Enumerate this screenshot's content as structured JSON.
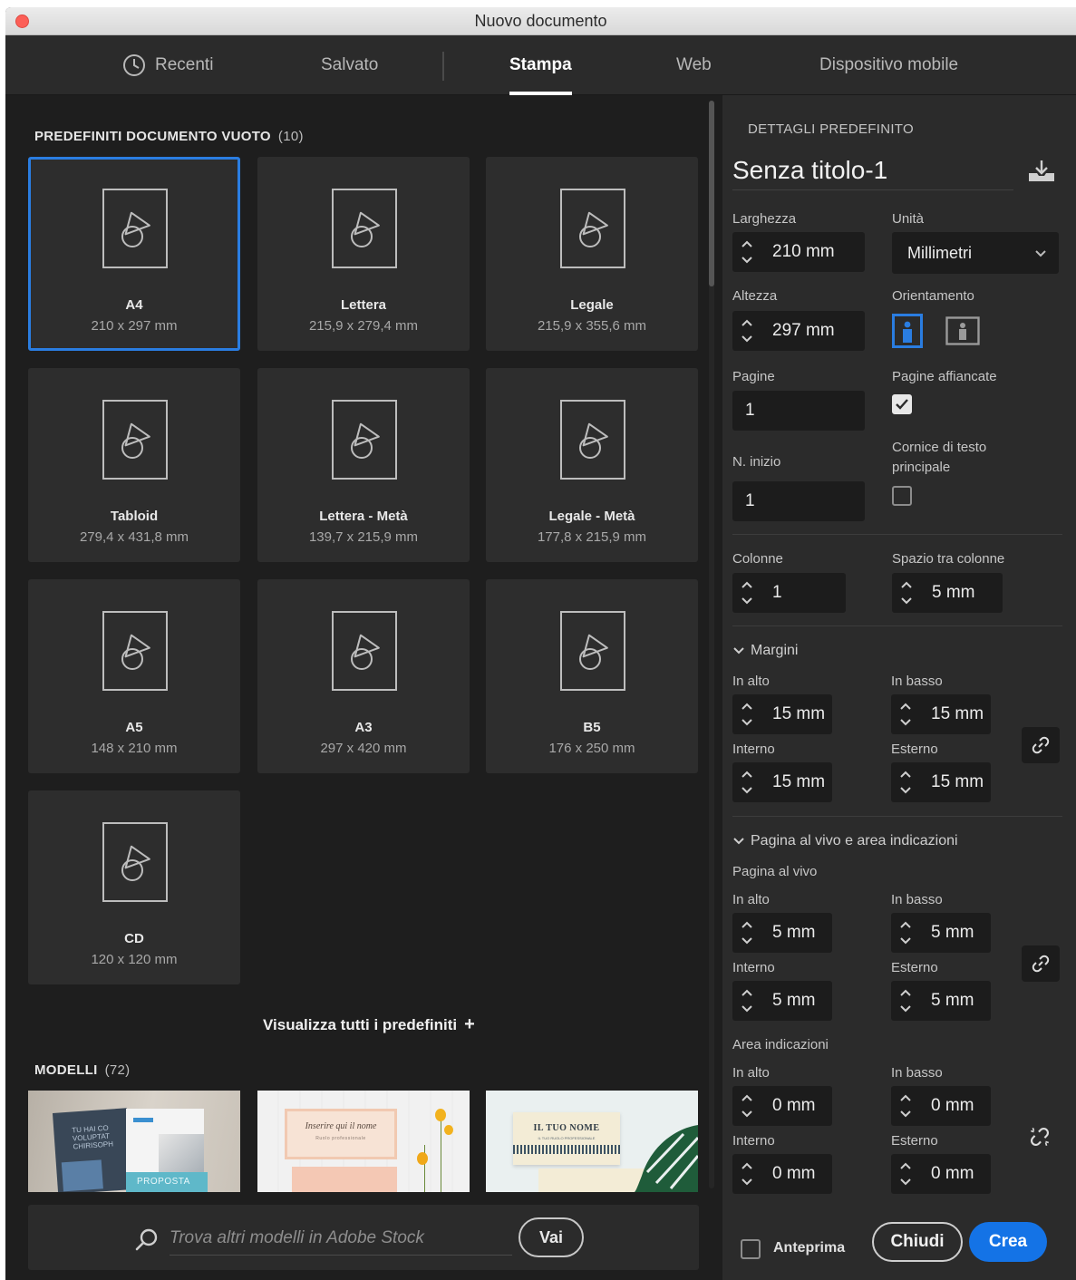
{
  "window": {
    "title": "Nuovo documento"
  },
  "tabs": {
    "recent": "Recenti",
    "saved": "Salvato",
    "print": "Stampa",
    "web": "Web",
    "mobile": "Dispositivo mobile"
  },
  "presets": {
    "heading": "PREDEFINITI DOCUMENTO VUOTO",
    "count": "(10)",
    "items": [
      {
        "name": "A4",
        "size": "210 x 297 mm"
      },
      {
        "name": "Lettera",
        "size": "215,9 x 279,4 mm"
      },
      {
        "name": "Legale",
        "size": "215,9 x 355,6 mm"
      },
      {
        "name": "Tabloid",
        "size": "279,4 x 431,8 mm"
      },
      {
        "name": "Lettera - Metà",
        "size": "139,7 x 215,9 mm"
      },
      {
        "name": "Legale - Metà",
        "size": "177,8 x 215,9 mm"
      },
      {
        "name": "A5",
        "size": "148 x 210 mm"
      },
      {
        "name": "A3",
        "size": "297 x 420 mm"
      },
      {
        "name": "B5",
        "size": "176 x 250 mm"
      },
      {
        "name": "CD",
        "size": "120 x 120 mm"
      }
    ],
    "view_all": "Visualizza tutti i predefiniti",
    "view_all_plus": "+"
  },
  "templates": {
    "heading": "MODELLI",
    "count": "(72)",
    "t1_text": "TU HAI CO VOLUPTAT CHIRISOPH",
    "t1_label": "PROPOSTA",
    "t2_text": "Inserire qui il nome",
    "t2_sub": "Ruolo professionale",
    "t3_text": "IL TUO NOME",
    "t3_sub": "IL TUO RUOLO PROFESSIONALE"
  },
  "search": {
    "placeholder": "Trova altri modelli in Adobe Stock",
    "go": "Vai"
  },
  "details": {
    "heading": "DETTAGLI PREDEFINITO",
    "name": "Senza titolo-1",
    "width_label": "Larghezza",
    "width": "210 mm",
    "units_label": "Unità",
    "units": "Millimetri",
    "height_label": "Altezza",
    "height": "297 mm",
    "orientation_label": "Orientamento",
    "pages_label": "Pagine",
    "pages": "1",
    "facing_label": "Pagine affiancate",
    "start_label": "N. inizio",
    "start": "1",
    "primary_frame_label_1": "Cornice di testo",
    "primary_frame_label_2": "principale",
    "columns_label": "Colonne",
    "columns": "1",
    "gutter_label": "Spazio tra colonne",
    "gutter": "5 mm"
  },
  "margins": {
    "title": "Margini",
    "top_label": "In alto",
    "top": "15 mm",
    "bottom_label": "In basso",
    "bottom": "15 mm",
    "inside_label": "Interno",
    "inside": "15 mm",
    "outside_label": "Esterno",
    "outside": "15 mm"
  },
  "bleed": {
    "title": "Pagina al vivo e area indicazioni",
    "bleed_label": "Pagina al vivo",
    "top_label": "In alto",
    "top": "5 mm",
    "bottom_label": "In basso",
    "bottom": "5 mm",
    "inside_label": "Interno",
    "inside": "5 mm",
    "outside_label": "Esterno",
    "outside": "5 mm",
    "slug_label": "Area indicazioni",
    "slug_top_label": "In alto",
    "slug_top": "0 mm",
    "slug_bottom_label": "In basso",
    "slug_bottom": "0 mm",
    "slug_inside_label": "Interno",
    "slug_inside": "0 mm",
    "slug_outside_label": "Esterno",
    "slug_outside": "0 mm"
  },
  "footer": {
    "preview": "Anteprima",
    "close": "Chiudi",
    "create": "Crea"
  },
  "colors": {
    "accent": "#1473e6",
    "selection": "#2a7de1",
    "panel": "#2b2b2b",
    "background": "#1e1e1e"
  }
}
